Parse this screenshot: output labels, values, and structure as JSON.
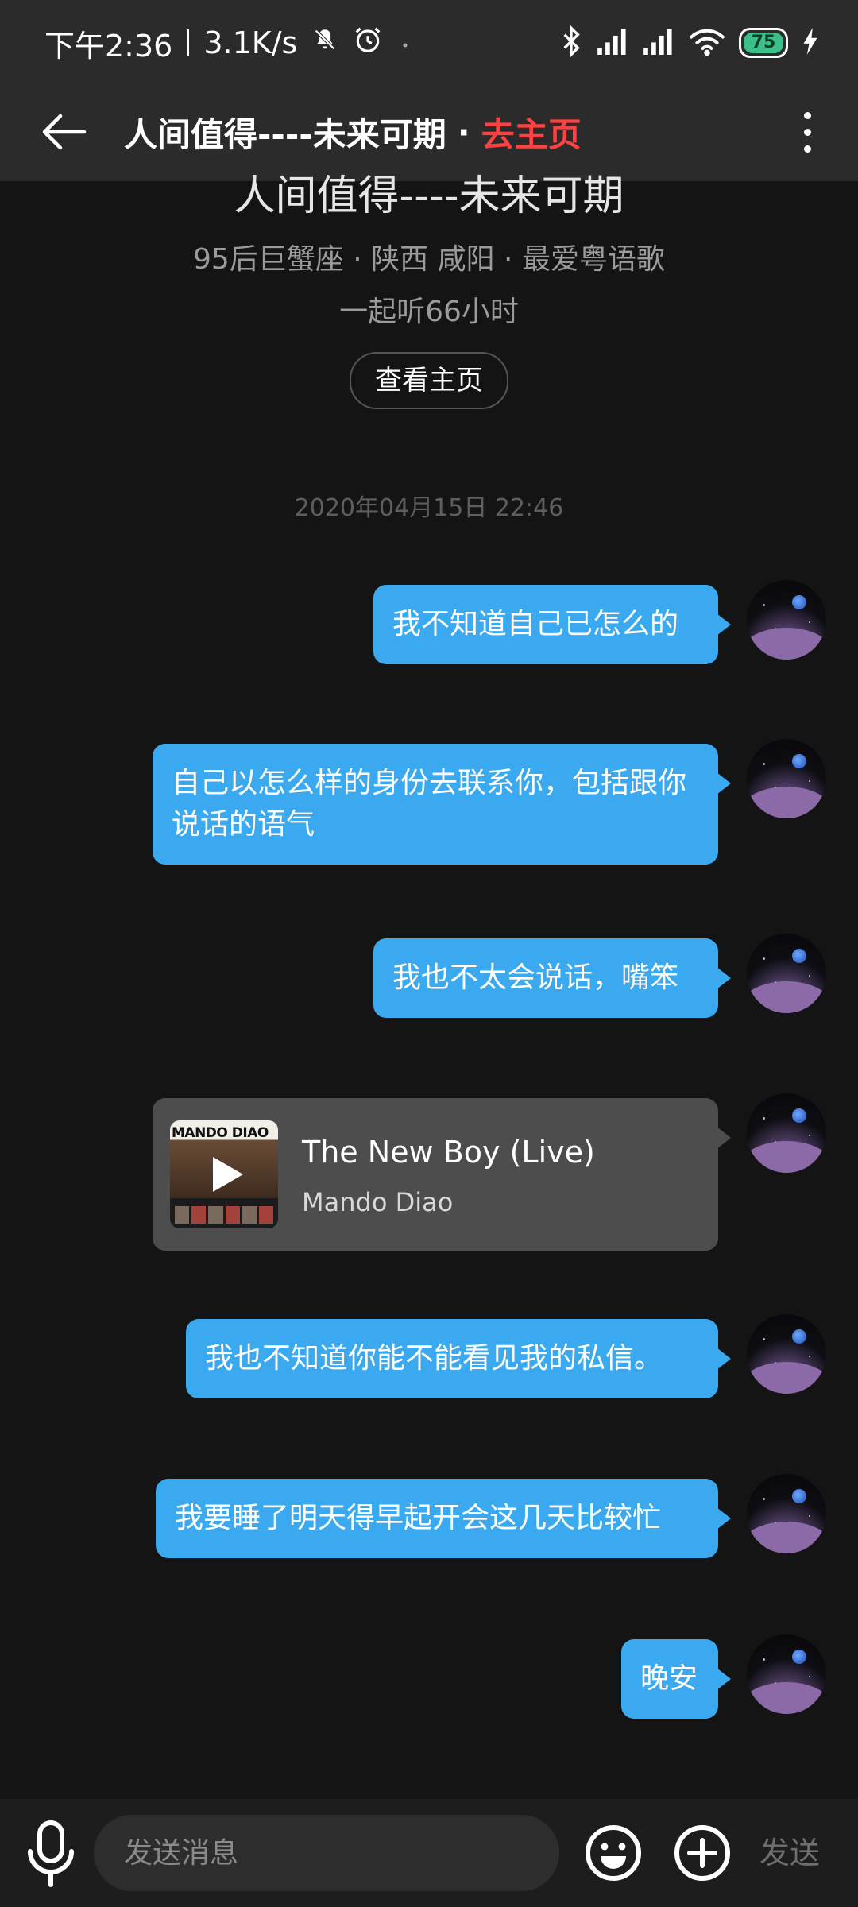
{
  "status_bar": {
    "time": "下午2:36",
    "network_speed": "3.1K/s",
    "battery_level": "75",
    "icons": [
      "mute-icon",
      "alarm-icon",
      "bluetooth-icon",
      "signal-icon",
      "wifi-icon",
      "charging-icon"
    ]
  },
  "nav": {
    "title": "人间值得----未来可期",
    "separator": "·",
    "home_link": "去主页",
    "accent_color": "#ff4141"
  },
  "profile": {
    "name": "人间值得----未来可期",
    "tags": "95后巨蟹座 · 陕西 咸阳 · 最爱粤语歌",
    "listen_together": "一起听66小时",
    "view_home_button": "查看主页"
  },
  "chat": {
    "timestamp": "2020年04月15日 22:46",
    "bubble_color": "#3aa9ef",
    "messages": [
      {
        "text": "我不知道自己已怎么的"
      },
      {
        "text": "自己以怎么样的身份去联系你，包括跟你说话的语气"
      },
      {
        "text": "我也不太会说话，嘴笨"
      },
      {
        "song_title": "The New Boy (Live)",
        "song_artist": "Mando Diao",
        "album_text": "MANDO DIAO"
      },
      {
        "text": "我也不知道你能不能看见我的私信。"
      },
      {
        "text": "我要睡了明天得早起开会这几天比较忙"
      },
      {
        "text": "晚安"
      }
    ]
  },
  "input_bar": {
    "placeholder": "发送消息",
    "send_label": "发送"
  }
}
